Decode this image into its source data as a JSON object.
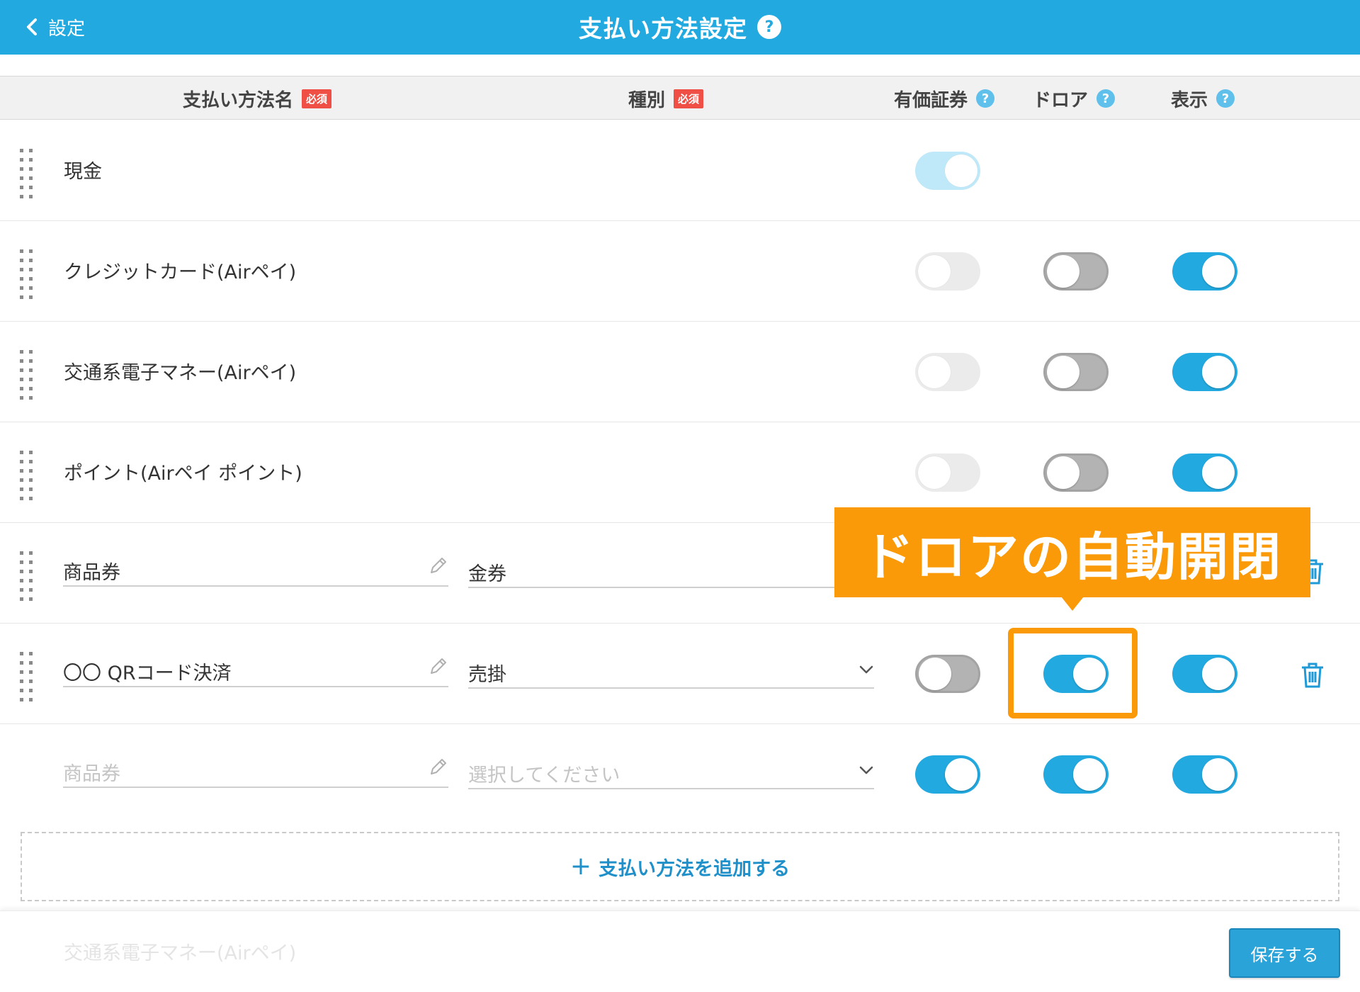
{
  "header": {
    "back_label": "設定",
    "title": "支払い方法設定",
    "help": "?"
  },
  "columns": {
    "name": "支払い方法名",
    "type": "種別",
    "required": "必須",
    "securities": "有価証券",
    "drawer": "ドロア",
    "display": "表示",
    "help": "?"
  },
  "rows": [
    {
      "name": "現金",
      "securities": "on-disabled"
    },
    {
      "name": "クレジットカード(Airペイ)",
      "securities": "off-disabled",
      "drawer": "off",
      "display": "on"
    },
    {
      "name": "交通系電子マネー(Airペイ)",
      "securities": "off-disabled",
      "drawer": "off",
      "display": "on"
    },
    {
      "name": "ポイント(Airペイ ポイント)",
      "securities": "off-disabled",
      "drawer": "off",
      "display": "on"
    },
    {
      "name": "商品券",
      "type": "金券"
    },
    {
      "name": "〇〇 QRコード決済",
      "type": "売掛",
      "securities": "off",
      "drawer": "on",
      "display": "on"
    },
    {
      "name_placeholder": "商品券",
      "type_placeholder": "選択してください",
      "securities": "on",
      "drawer": "on",
      "display": "on"
    }
  ],
  "callout": {
    "text": "ドロアの自動開閉",
    "color": "#fb9a09"
  },
  "add_button": "支払い方法を追加する",
  "footer": {
    "ghost_text": "交通系電子マネー(Airペイ)",
    "save_label": "保存する"
  },
  "colors": {
    "header": "#22a9e0",
    "accent": "#22a9e0",
    "required_badge": "#f04f45"
  },
  "icons": [
    "chevron-left-icon",
    "help-icon",
    "drag-handle-icon",
    "pencil-icon",
    "chevron-down-icon",
    "trash-icon",
    "plus-icon"
  ]
}
